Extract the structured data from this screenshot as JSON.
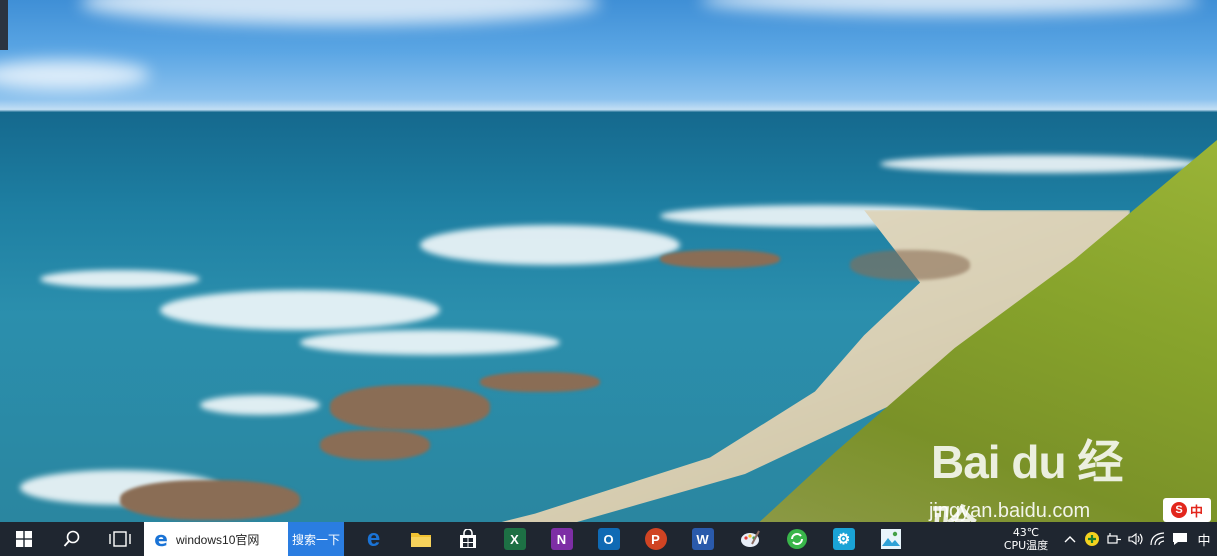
{
  "taskbar": {
    "search": {
      "value": "windows10官网",
      "button_label": "搜索一下"
    },
    "apps": [
      {
        "name": "edge-icon",
        "glyph": "e",
        "color": "#1a73d6"
      },
      {
        "name": "file-explorer-icon",
        "glyph": "",
        "color": "#f1c232"
      },
      {
        "name": "store-icon",
        "glyph": "",
        "color": "#ffffff"
      },
      {
        "name": "excel-icon",
        "glyph": "X",
        "color": "#1d7044"
      },
      {
        "name": "onenote-icon",
        "glyph": "N",
        "color": "#7d2ea5"
      },
      {
        "name": "outlook-icon",
        "glyph": "O",
        "color": "#0f6ab4"
      },
      {
        "name": "powerpoint-icon",
        "glyph": "P",
        "color": "#d04423"
      },
      {
        "name": "word-icon",
        "glyph": "W",
        "color": "#2a5aab"
      },
      {
        "name": "paint-icon",
        "glyph": "",
        "color": "#e8eef7"
      },
      {
        "name": "refresh-app-icon",
        "glyph": "",
        "color": "#39b54a"
      },
      {
        "name": "settings-app-icon",
        "glyph": "⚙",
        "color": "#1aa3d6"
      },
      {
        "name": "photos-app-icon",
        "glyph": "",
        "color": "#2fa1d6"
      }
    ],
    "tray": {
      "temperature": "43℃",
      "temperature_label": "CPU温度",
      "ime": "中"
    }
  },
  "watermark": {
    "brand": "Bai du 经验",
    "url": "jingyan.baidu.com"
  },
  "ime_float": {
    "badge": "S",
    "label": "中"
  }
}
